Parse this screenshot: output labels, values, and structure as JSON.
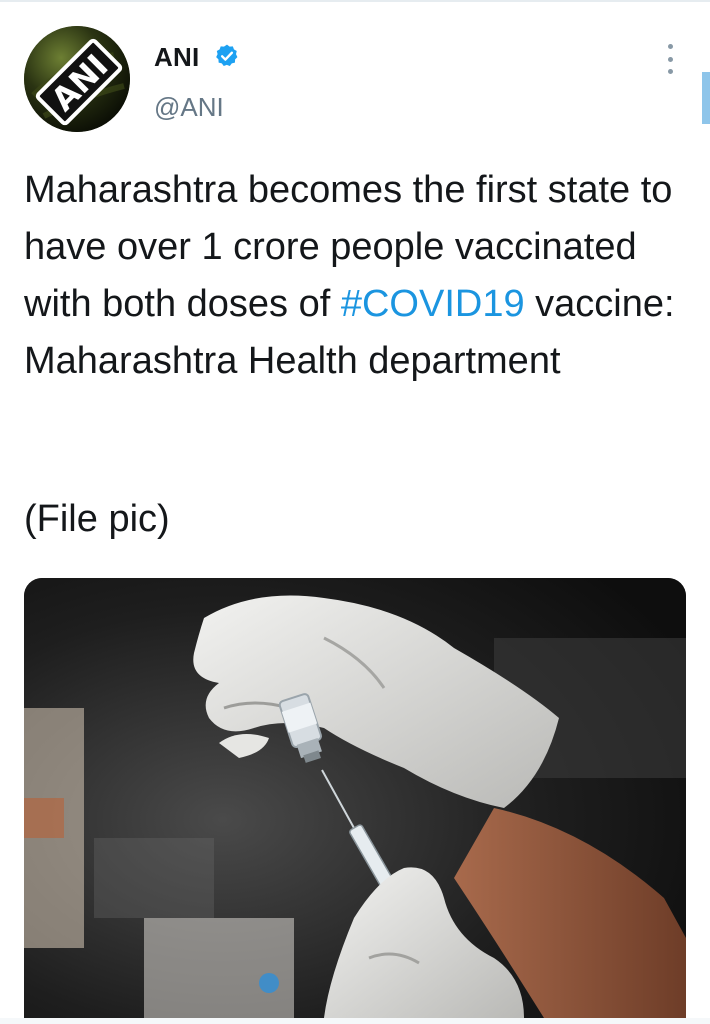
{
  "tweet": {
    "author_name": "ANI",
    "author_handle": "@ANI",
    "verified": true,
    "avatar_text": "ANI",
    "text_before_hashtag": "Maharashtra becomes the first state to have over 1 crore people vaccinated with both doses of ",
    "hashtag": "#COVID19",
    "text_after_hashtag": " vaccine: Maharashtra Health department",
    "caption": "(File pic)"
  },
  "icons": {
    "verified": "verified-badge-icon",
    "more": "more-vertical-icon"
  },
  "colors": {
    "name": "#14171a",
    "handle": "#657786",
    "hashtag": "#1b95e0",
    "verified": "#1da1f2"
  }
}
